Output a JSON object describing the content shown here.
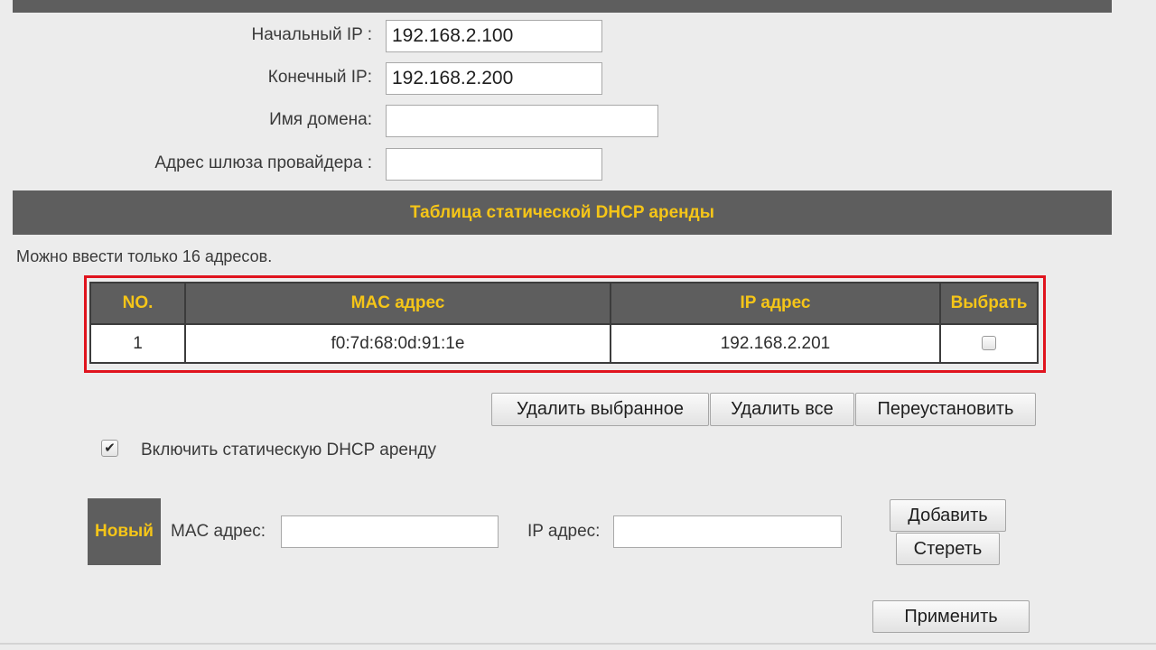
{
  "lan_form": {
    "start_ip": {
      "label": "Начальный IP :",
      "value": "192.168.2.100"
    },
    "end_ip": {
      "label": "Конечный IP:",
      "value": "192.168.2.200"
    },
    "domain_name": {
      "label": "Имя домена:",
      "value": ""
    },
    "isp_gateway": {
      "label": "Адрес шлюза провайдера :",
      "value": ""
    }
  },
  "static_lease_section": {
    "title": "Таблица статической DHCP аренды",
    "limit_note": "Можно ввести только 16 адресов.",
    "table": {
      "columns": [
        "NO.",
        "MAC адрес",
        "IP адрес",
        "Выбрать"
      ],
      "rows": [
        {
          "no": "1",
          "mac": "f0:7d:68:0d:91:1e",
          "ip": "192.168.2.201",
          "selected": false
        }
      ]
    },
    "buttons": {
      "delete_selected": "Удалить выбранное",
      "delete_all": "Удалить все",
      "reset": "Переустановить"
    },
    "enable_static_lease": {
      "label": "Включить статическую DHCP аренду",
      "checked": true,
      "check_glyph": "✔"
    }
  },
  "new_entry": {
    "badge": "Новый",
    "mac_label": "MAC адрес:",
    "mac_value": "",
    "ip_label": "IP адрес:",
    "ip_value": "",
    "add_button": "Добавить",
    "clear_button": "Стереть"
  },
  "apply_button": "Применить",
  "colors": {
    "header_bg": "#5e5e5e",
    "header_text": "#f5c518",
    "highlight_frame": "#e0141e",
    "page_bg": "#ececec"
  },
  "icons": {
    "enable_checkbox": "checkmark-icon",
    "row_select": "checkbox-unchecked-icon"
  }
}
